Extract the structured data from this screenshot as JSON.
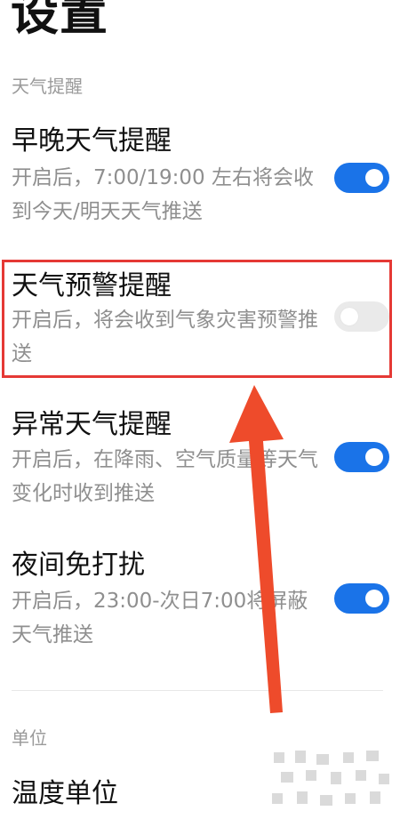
{
  "page": {
    "title": "设置"
  },
  "sections": {
    "weather": {
      "header": "天气提醒"
    },
    "unit": {
      "header": "单位"
    }
  },
  "items": {
    "morning_evening": {
      "title": "早晚天气提醒",
      "desc": "开启后，7:00/19:00 左右将会收到今天/明天天气推送",
      "toggle": "on"
    },
    "warning": {
      "title": "天气预警提醒",
      "desc": "开启后，将会收到气象灾害预警推送",
      "toggle": "off"
    },
    "abnormal": {
      "title": "异常天气提醒",
      "desc": "开启后，在降雨、空气质量等天气变化时收到推送",
      "toggle": "on"
    },
    "night": {
      "title": "夜间免打扰",
      "desc": "开启后，23:00-次日7:00将屏蔽天气推送",
      "toggle": "on"
    },
    "temperature_unit": {
      "title": "温度单位"
    }
  },
  "colors": {
    "accent": "#1a73e8",
    "highlight": "#e53935",
    "arrow": "#ee4b2b"
  },
  "icons": {
    "watermark": "watermark-icon"
  }
}
